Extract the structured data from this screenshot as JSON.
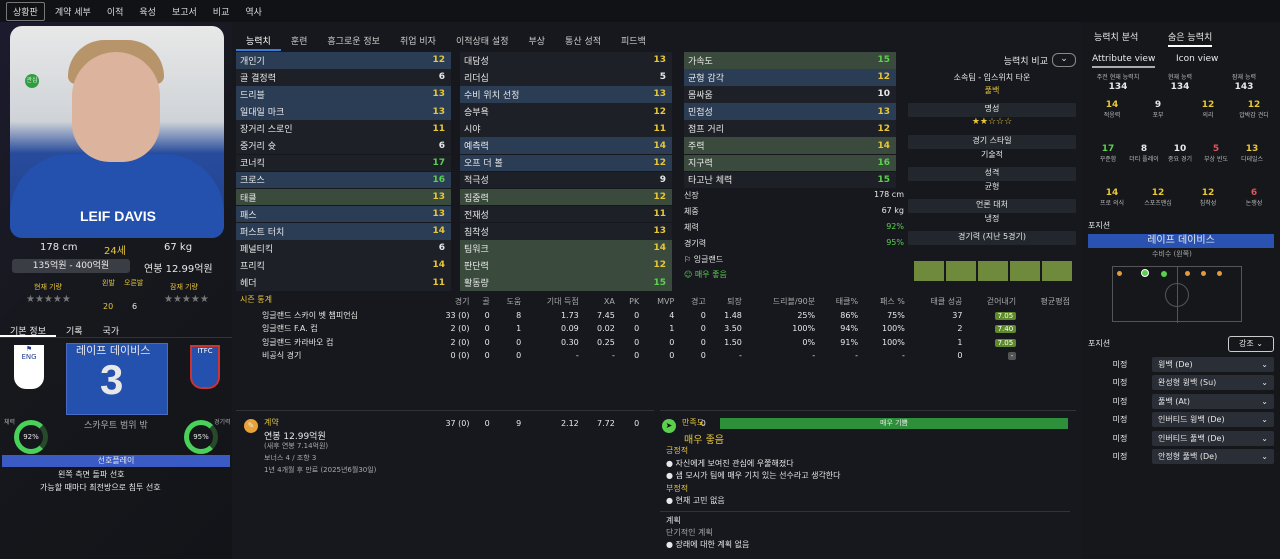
{
  "nav": [
    "상황판",
    "계약 세부",
    "이적",
    "육성",
    "보고서",
    "비교",
    "역사"
  ],
  "player": {
    "shirt_name": "LEIF DAVIS",
    "height": "178 cm",
    "age": "24세",
    "weight": "67 kg",
    "value": "135억원 - 400억원",
    "salary": "연봉 12.99억원",
    "current_label": "현재 기량",
    "potential_label": "잠재 기량",
    "left_foot": "왼발",
    "right_foot": "오른발",
    "left_foot_v": "20",
    "right_foot_v": "6",
    "name_kr": "레이프 데이비스",
    "number": "3",
    "scout_note": "스카우트 범위 밖",
    "fitness_label": "체력",
    "fitness": "92%",
    "condition_label": "경기력",
    "condition": "95%",
    "style_header": "선호플레이",
    "style1": "왼쪽 측면 돌파 선호",
    "style2": "가능할 때마다 최전방으로 침투 선호"
  },
  "left_tabs": [
    "기본 정보",
    "기록",
    "국가"
  ],
  "tabs": [
    "능력치",
    "훈련",
    "흥그로운 정보",
    "취업 비자",
    "이적상태 설정",
    "부상",
    "통산 성적",
    "피드백"
  ],
  "attr_col1": [
    [
      "개인기",
      "12"
    ],
    [
      "골 결정력",
      "6"
    ],
    [
      "드리블",
      "13"
    ],
    [
      "일대일 마크",
      "13"
    ],
    [
      "장거리 스로인",
      "11"
    ],
    [
      "중거리 슛",
      "6"
    ],
    [
      "코너킥",
      "17"
    ],
    [
      "크로스",
      "16"
    ],
    [
      "태클",
      "13"
    ],
    [
      "패스",
      "13"
    ],
    [
      "퍼스트 터치",
      "14"
    ],
    [
      "페널티킥",
      "6"
    ],
    [
      "프리킥",
      "14"
    ],
    [
      "헤더",
      "11"
    ]
  ],
  "attr_col2": [
    [
      "대담성",
      "13"
    ],
    [
      "리더십",
      "5"
    ],
    [
      "수비 위치 선정",
      "13"
    ],
    [
      "승부욕",
      "12"
    ],
    [
      "시야",
      "11"
    ],
    [
      "예측력",
      "14"
    ],
    [
      "오프 더 볼",
      "12"
    ],
    [
      "적극성",
      "9"
    ],
    [
      "집중력",
      "12"
    ],
    [
      "전재성",
      "11"
    ],
    [
      "침착성",
      "13"
    ],
    [
      "팀워크",
      "14"
    ],
    [
      "판단력",
      "12"
    ],
    [
      "활동량",
      "15"
    ]
  ],
  "attr_col3": [
    [
      "가속도",
      "15"
    ],
    [
      "균형 감각",
      "12"
    ],
    [
      "몸싸움",
      "10"
    ],
    [
      "민첩성",
      "13"
    ],
    [
      "점프 거리",
      "12"
    ],
    [
      "주력",
      "14"
    ],
    [
      "지구력",
      "16"
    ],
    [
      "타고난 체력",
      "15"
    ]
  ],
  "mid_info": {
    "height_l": "신장",
    "height": "178 cm",
    "weight_l": "체중",
    "weight": "67 kg",
    "fit_l": "체력",
    "fit": "92%",
    "cond_l": "경기력",
    "cond": "95%",
    "nation": "잉글랜드",
    "morale": "매우 좋음"
  },
  "compare": {
    "label": "능력치 비교",
    "club": "소속팀 - 입스위치 타운",
    "pos": "풀백",
    "rep": "명성",
    "style": "경기 스타일",
    "style_v": "기술적",
    "person": "성격",
    "person_v": "균형",
    "media": "언론 대처",
    "media_v": "냉정",
    "form": "경기력 (지난 5경기)"
  },
  "season": {
    "title": "시즌 통계",
    "headers": [
      "경기",
      "골",
      "도움",
      "기대 득점",
      "XA",
      "PK",
      "MVP",
      "경고",
      "퇴장",
      "드리블/90분",
      "태클%",
      "패스 %",
      "태클 성공",
      "걷어내기",
      "평균평점"
    ],
    "rows": [
      [
        "잉글랜드 스카이 벳 챔피언십",
        "33 (0)",
        "0",
        "8",
        "1.73",
        "7.45",
        "0",
        "4",
        "0",
        "1.48",
        "25%",
        "86%",
        "75%",
        "37",
        "7.05"
      ],
      [
        "잉글랜드 F.A. 컵",
        "2 (0)",
        "0",
        "1",
        "0.09",
        "0.02",
        "0",
        "1",
        "0",
        "3.50",
        "100%",
        "94%",
        "100%",
        "2",
        "7.40"
      ],
      [
        "잉글랜드 카라바오 컵",
        "2 (0)",
        "0",
        "0",
        "0.30",
        "0.25",
        "0",
        "0",
        "0",
        "1.50",
        "0%",
        "91%",
        "100%",
        "1",
        "7.05"
      ],
      [
        "비공식 경기",
        "0 (0)",
        "0",
        "0",
        "-",
        "-",
        "0",
        "0",
        "0",
        "-",
        "-",
        "-",
        "-",
        "0",
        "-"
      ]
    ],
    "total": [
      "37 (0)",
      "0",
      "9",
      "2.12",
      "7.72",
      "0",
      "5",
      "0",
      "1.59",
      "29%",
      "87%",
      "78%",
      "40",
      "7.08"
    ]
  },
  "contract": {
    "title": "계약",
    "salary": "연봉 12.99억원",
    "sub": "(새후 연봉 7.14억원)",
    "bonus": "보너스 4 / 조항 3",
    "end": "1년 4개월 후 만료 (2025년6월30일)"
  },
  "satisfaction": {
    "title": "만족도",
    "bar": "매우 기쁨",
    "level": "매우 좋음",
    "pos_h": "긍정적",
    "pos1": "자신에게 보여진 관심에 우쭐해졌다",
    "pos2": "샘 모시가 팀에 매우 기치 있는 선수라고 생각한다",
    "neg_h": "부정적",
    "neg1": "현재 고민 없음",
    "plan_h": "계획",
    "plan_sub": "단기적인 계획",
    "plan1": "장래에 대한 계획 없음"
  },
  "right": {
    "tab1": "능력치 분석",
    "tab2": "숨은 능력치",
    "view1": "Attribute view",
    "view2": "Icon view",
    "h1": "주전 현재 능력치",
    "h2": "현재 능력",
    "h3": "잠재 능력",
    "v1": "134",
    "v2": "134",
    "v3": "143",
    "hidden": [
      [
        "14",
        "적응력"
      ],
      [
        "9",
        "포부"
      ],
      [
        "12",
        "의리"
      ],
      [
        "12",
        "압박감 견디"
      ],
      [
        "17",
        "꾸준함"
      ],
      [
        "8",
        "더티 플레이"
      ],
      [
        "10",
        "중요 경기"
      ],
      [
        "5",
        "부상 빈도"
      ],
      [
        "13",
        "디테일스"
      ],
      [
        "14",
        "프로 의식"
      ],
      [
        "12",
        "스포츠맨십"
      ],
      [
        "12",
        "침착성"
      ],
      [
        "6",
        "논쟁성"
      ]
    ],
    "pos_title": "포지션",
    "pos_main": "레이프 데이비스",
    "pos_sub": "수비수 (왼쪽)",
    "pos2_title": "포지션",
    "role_btn": "강조",
    "roles": [
      [
        "미정",
        "윙백 (De)"
      ],
      [
        "미정",
        "완성형 윙백 (Su)"
      ],
      [
        "미정",
        "풀백 (At)"
      ],
      [
        "미정",
        "인버티드 윙백 (De)"
      ],
      [
        "미정",
        "인버티드 풀백 (De)"
      ],
      [
        "미정",
        "안정형 풀백 (De)"
      ]
    ]
  },
  "colors": {
    "accent": "#3a7bd5",
    "green": "#5bd04f",
    "yellow": "#e7c63a"
  }
}
